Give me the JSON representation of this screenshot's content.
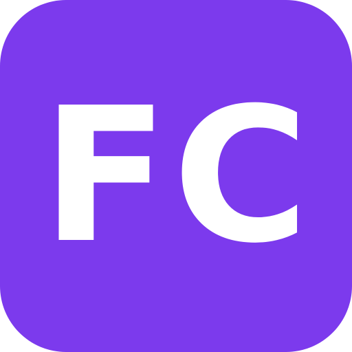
{
  "app_icon": {
    "monogram": "FC",
    "background_color": "#7c3aed",
    "text_color": "#ffffff"
  }
}
